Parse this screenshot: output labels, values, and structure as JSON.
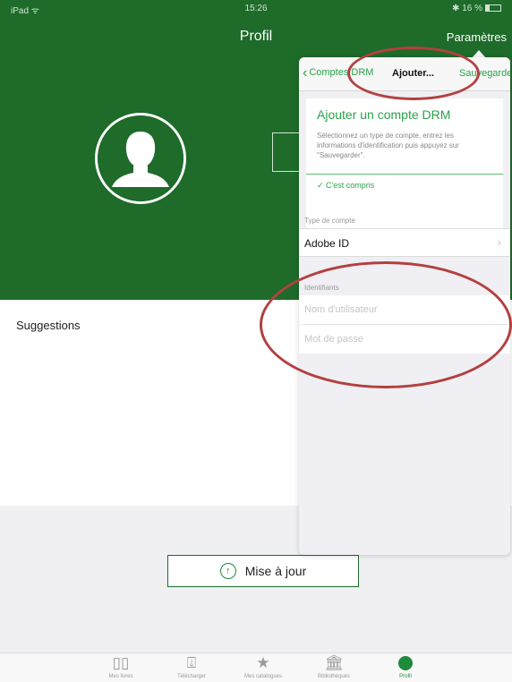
{
  "status_bar": {
    "device": "iPad ᯤ",
    "time": "15:26",
    "battery": "✱ 16 %"
  },
  "header": {
    "title": "Profil",
    "settings_label": "Paramètres"
  },
  "main": {
    "suggestions_label": "Suggestions",
    "update_button": {
      "label": "Mise à jour",
      "icon": "↑"
    }
  },
  "popover": {
    "back_label": "Comptes DRM",
    "title": "Ajouter...",
    "save_label": "Sauvegarder",
    "info": {
      "title": "Ajouter un compte DRM",
      "text": "Sélectionnez un type de compte, entrez les informations d'identification puis appuyez sur \"Sauvegarder\".",
      "confirm": "✓ C'est compris"
    },
    "account_type_section": "Type de compte",
    "account_type_value": "Adobe ID",
    "credentials_section": "Identifiants",
    "username_placeholder": "Nom d'utilisateur",
    "password_placeholder": "Mot de passe"
  },
  "tabbar": {
    "items": [
      {
        "label": "Mes livres",
        "icon": "books-icon"
      },
      {
        "label": "Télécharger",
        "icon": "download-icon"
      },
      {
        "label": "Mes catalogues",
        "icon": "star-icon"
      },
      {
        "label": "Bibliothèques",
        "icon": "library-icon"
      },
      {
        "label": "Profil",
        "icon": "profile-icon"
      }
    ]
  },
  "colors": {
    "brand_green": "#1e6b2a",
    "accent_green": "#2aa34a",
    "annotation_red": "#b3403f"
  }
}
